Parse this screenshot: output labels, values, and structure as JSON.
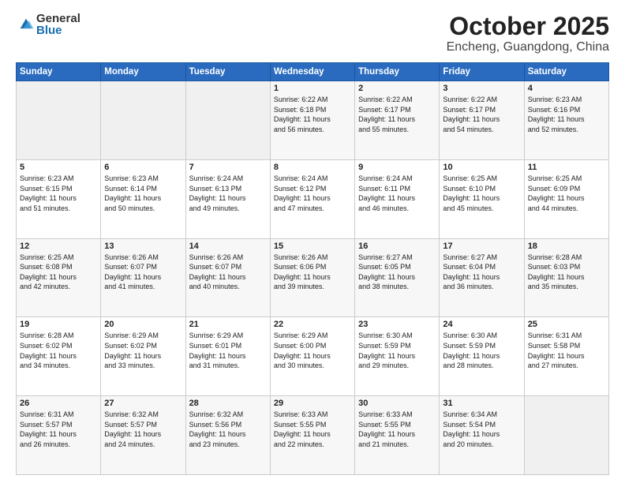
{
  "header": {
    "logo_general": "General",
    "logo_blue": "Blue",
    "title": "October 2025",
    "location": "Encheng, Guangdong, China"
  },
  "weekdays": [
    "Sunday",
    "Monday",
    "Tuesday",
    "Wednesday",
    "Thursday",
    "Friday",
    "Saturday"
  ],
  "weeks": [
    [
      {
        "day": "",
        "info": ""
      },
      {
        "day": "",
        "info": ""
      },
      {
        "day": "",
        "info": ""
      },
      {
        "day": "1",
        "info": "Sunrise: 6:22 AM\nSunset: 6:18 PM\nDaylight: 11 hours\nand 56 minutes."
      },
      {
        "day": "2",
        "info": "Sunrise: 6:22 AM\nSunset: 6:17 PM\nDaylight: 11 hours\nand 55 minutes."
      },
      {
        "day": "3",
        "info": "Sunrise: 6:22 AM\nSunset: 6:17 PM\nDaylight: 11 hours\nand 54 minutes."
      },
      {
        "day": "4",
        "info": "Sunrise: 6:23 AM\nSunset: 6:16 PM\nDaylight: 11 hours\nand 52 minutes."
      }
    ],
    [
      {
        "day": "5",
        "info": "Sunrise: 6:23 AM\nSunset: 6:15 PM\nDaylight: 11 hours\nand 51 minutes."
      },
      {
        "day": "6",
        "info": "Sunrise: 6:23 AM\nSunset: 6:14 PM\nDaylight: 11 hours\nand 50 minutes."
      },
      {
        "day": "7",
        "info": "Sunrise: 6:24 AM\nSunset: 6:13 PM\nDaylight: 11 hours\nand 49 minutes."
      },
      {
        "day": "8",
        "info": "Sunrise: 6:24 AM\nSunset: 6:12 PM\nDaylight: 11 hours\nand 47 minutes."
      },
      {
        "day": "9",
        "info": "Sunrise: 6:24 AM\nSunset: 6:11 PM\nDaylight: 11 hours\nand 46 minutes."
      },
      {
        "day": "10",
        "info": "Sunrise: 6:25 AM\nSunset: 6:10 PM\nDaylight: 11 hours\nand 45 minutes."
      },
      {
        "day": "11",
        "info": "Sunrise: 6:25 AM\nSunset: 6:09 PM\nDaylight: 11 hours\nand 44 minutes."
      }
    ],
    [
      {
        "day": "12",
        "info": "Sunrise: 6:25 AM\nSunset: 6:08 PM\nDaylight: 11 hours\nand 42 minutes."
      },
      {
        "day": "13",
        "info": "Sunrise: 6:26 AM\nSunset: 6:07 PM\nDaylight: 11 hours\nand 41 minutes."
      },
      {
        "day": "14",
        "info": "Sunrise: 6:26 AM\nSunset: 6:07 PM\nDaylight: 11 hours\nand 40 minutes."
      },
      {
        "day": "15",
        "info": "Sunrise: 6:26 AM\nSunset: 6:06 PM\nDaylight: 11 hours\nand 39 minutes."
      },
      {
        "day": "16",
        "info": "Sunrise: 6:27 AM\nSunset: 6:05 PM\nDaylight: 11 hours\nand 38 minutes."
      },
      {
        "day": "17",
        "info": "Sunrise: 6:27 AM\nSunset: 6:04 PM\nDaylight: 11 hours\nand 36 minutes."
      },
      {
        "day": "18",
        "info": "Sunrise: 6:28 AM\nSunset: 6:03 PM\nDaylight: 11 hours\nand 35 minutes."
      }
    ],
    [
      {
        "day": "19",
        "info": "Sunrise: 6:28 AM\nSunset: 6:02 PM\nDaylight: 11 hours\nand 34 minutes."
      },
      {
        "day": "20",
        "info": "Sunrise: 6:29 AM\nSunset: 6:02 PM\nDaylight: 11 hours\nand 33 minutes."
      },
      {
        "day": "21",
        "info": "Sunrise: 6:29 AM\nSunset: 6:01 PM\nDaylight: 11 hours\nand 31 minutes."
      },
      {
        "day": "22",
        "info": "Sunrise: 6:29 AM\nSunset: 6:00 PM\nDaylight: 11 hours\nand 30 minutes."
      },
      {
        "day": "23",
        "info": "Sunrise: 6:30 AM\nSunset: 5:59 PM\nDaylight: 11 hours\nand 29 minutes."
      },
      {
        "day": "24",
        "info": "Sunrise: 6:30 AM\nSunset: 5:59 PM\nDaylight: 11 hours\nand 28 minutes."
      },
      {
        "day": "25",
        "info": "Sunrise: 6:31 AM\nSunset: 5:58 PM\nDaylight: 11 hours\nand 27 minutes."
      }
    ],
    [
      {
        "day": "26",
        "info": "Sunrise: 6:31 AM\nSunset: 5:57 PM\nDaylight: 11 hours\nand 26 minutes."
      },
      {
        "day": "27",
        "info": "Sunrise: 6:32 AM\nSunset: 5:57 PM\nDaylight: 11 hours\nand 24 minutes."
      },
      {
        "day": "28",
        "info": "Sunrise: 6:32 AM\nSunset: 5:56 PM\nDaylight: 11 hours\nand 23 minutes."
      },
      {
        "day": "29",
        "info": "Sunrise: 6:33 AM\nSunset: 5:55 PM\nDaylight: 11 hours\nand 22 minutes."
      },
      {
        "day": "30",
        "info": "Sunrise: 6:33 AM\nSunset: 5:55 PM\nDaylight: 11 hours\nand 21 minutes."
      },
      {
        "day": "31",
        "info": "Sunrise: 6:34 AM\nSunset: 5:54 PM\nDaylight: 11 hours\nand 20 minutes."
      },
      {
        "day": "",
        "info": ""
      }
    ]
  ]
}
